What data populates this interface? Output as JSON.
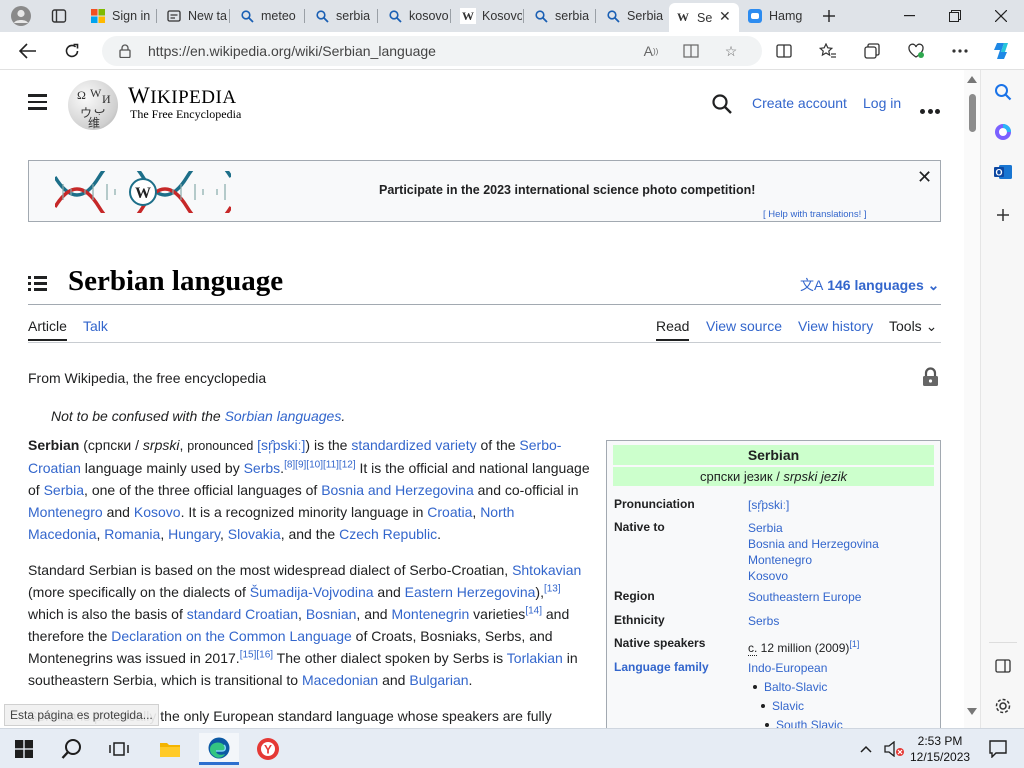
{
  "browser": {
    "tabs": [
      {
        "title": "",
        "icon": "profile-icon"
      },
      {
        "title": "",
        "icon": "tab-actions-icon"
      },
      {
        "title": "Sign in",
        "icon": "microsoft-icon"
      },
      {
        "title": "New ta",
        "icon": "newtab-icon"
      },
      {
        "title": "meteo",
        "icon": "search-icon"
      },
      {
        "title": "serbia",
        "icon": "search-icon"
      },
      {
        "title": "kosovo",
        "icon": "search-icon"
      },
      {
        "title": "Kosovo",
        "icon": "wikipedia-icon"
      },
      {
        "title": "serbia",
        "icon": "search-icon"
      },
      {
        "title": "Serbia",
        "icon": "search-icon"
      },
      {
        "title": "Se",
        "icon": "wikipedia-icon"
      },
      {
        "title": "Hamg",
        "icon": "hamgam-icon"
      }
    ],
    "url": "https://en.wikipedia.org/wiki/Serbian_language"
  },
  "header": {
    "logo_word": "WIKIPEDIA",
    "logo_word_first": "W",
    "logo_word_rest": "IKIPEDIA",
    "tagline": "The Free Encyclopedia",
    "create_account": "Create account",
    "log_in": "Log in"
  },
  "banner": {
    "text": "Participate in the 2023 international science photo competition!",
    "help": "[ Help with translations! ]"
  },
  "article": {
    "title": "Serbian language",
    "languages": "146 languages",
    "tabs": {
      "article": "Article",
      "talk": "Talk",
      "read": "Read",
      "view_source": "View source",
      "view_history": "View history",
      "tools": "Tools"
    },
    "from": "From Wikipedia, the free encyclopedia",
    "hatnote_prefix": "Not to be confused with the ",
    "hatnote_link": "Sorbian languages",
    "hatnote_suffix": ".",
    "p1": {
      "bold": "Serbian",
      "a": " (српски / ",
      "b": "srpski",
      "c": ", ",
      "pron": "pronounced",
      "d": " ",
      "ipa": "[sr̩̂pskiː]",
      "e": ") is the ",
      "l1": "standardized variety",
      "f": " of the ",
      "l2": "Serbo-Croatian",
      "g": " language mainly used by ",
      "l3": "Serbs",
      "h": ".",
      "refs1": "[8][9][10][11][12]",
      "i": " It is the official and national language of ",
      "l4": "Serbia",
      "j": ", one of the three official languages of ",
      "l5": "Bosnia and Herzegovina",
      "k": " and co-official in ",
      "l6": "Montenegro",
      "l": " and ",
      "l7": "Kosovo",
      "m": ". It is a recognized minority language in ",
      "l8": "Croatia",
      "n": ", ",
      "l9": "North Macedonia",
      "o": ", ",
      "l10": "Romania",
      "p": ", ",
      "l11": "Hungary",
      "q": ", ",
      "l12": "Slovakia",
      "r": ", and the ",
      "l13": "Czech Republic",
      "s": "."
    },
    "p2": {
      "a": "Standard Serbian is based on the most widespread dialect of Serbo-Croatian, ",
      "l1": "Shtokavian",
      "b": " (more specifically on the dialects of ",
      "l2": "Šumadija-Vojvodina",
      "c": " and ",
      "l3": "Eastern Herzegovina",
      "d": "),",
      "r1": "[13]",
      "e": " which is also the basis of ",
      "l4": "standard Croatian",
      "f": ", ",
      "l5": "Bosnian",
      "g": ", and ",
      "l6": "Montenegrin",
      "h": " varieties",
      "r2": "[14]",
      "i": " and therefore the ",
      "l7": "Declaration on the Common Language",
      "j": " of Croats, Bosniaks, Serbs, and Montenegrins was issued in 2017.",
      "r3": "[15][16]",
      "k": " The other dialect spoken by Serbs is ",
      "l8": "Torlakian",
      "l": " in southeastern Serbia, which is transitional to ",
      "l9": "Macedonian",
      "m": " and ",
      "l10": "Bulgarian",
      "n": "."
    },
    "p3": "Serbian is practically the only European standard language whose speakers are fully"
  },
  "infobox": {
    "title": "Serbian",
    "native_cyr": "српски језик",
    "native_sep": " / ",
    "native_lat": "srpski jezik",
    "pronunciation_label": "Pronunciation",
    "pronunciation": "[sr̩̂pskiː]",
    "native_to_label": "Native to",
    "native_to": [
      "Serbia",
      "Bosnia and Herzegovina",
      "Montenegro",
      "Kosovo"
    ],
    "region_label": "Region",
    "region": "Southeastern Europe",
    "ethnicity_label": "Ethnicity",
    "ethnicity": "Serbs",
    "speakers_label": "Native speakers",
    "speakers_c": "c.",
    "speakers": " 12 million (2009)",
    "speakers_ref": "[1]",
    "family_label": "Language family",
    "family": [
      "Indo-European",
      "Balto-Slavic",
      "Slavic",
      "South Slavic"
    ]
  },
  "status_tip": "Esta página es protegida...",
  "taskbar": {
    "time": "2:53 PM",
    "date": "12/15/2023"
  },
  "colors": {
    "link": "#3366cc",
    "infobox_header": "#ccffcc",
    "edge_blue": "#0c59a4"
  }
}
